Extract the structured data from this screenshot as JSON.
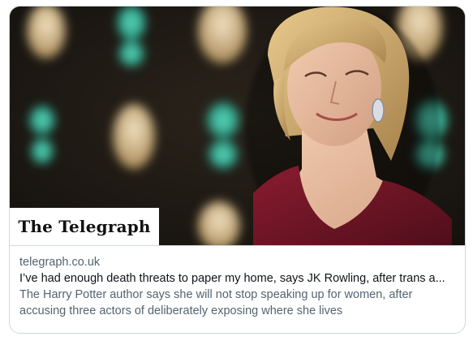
{
  "link_card": {
    "image": {
      "description_icon": "portrait-photo",
      "masthead": "The Telegraph"
    },
    "domain": "telegraph.co.uk",
    "headline": "I’ve had enough death threats to paper my home, says JK Rowling, after trans a...",
    "description": "The Harry Potter author says she will not stop speaking up for women, after accusing three actors of deliberately exposing where she lives"
  },
  "colors": {
    "border": "#cfd9de",
    "primary_text": "#0f1419",
    "secondary_text": "#536471",
    "dress": "#6b1424",
    "background_dark": "#1c1712"
  }
}
